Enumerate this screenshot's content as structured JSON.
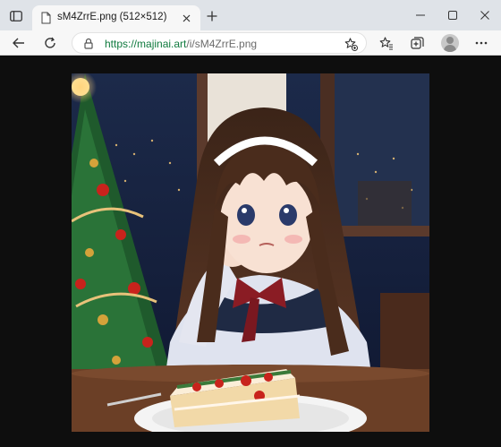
{
  "tab": {
    "title": "sM4ZrrE.png (512×512)"
  },
  "address": {
    "scheme": "https://",
    "host": "majinai.art",
    "path": "/i/sM4ZrrE.png"
  },
  "image": {
    "alt": "Anime girl in school uniform resting her cheek on her hand beside a Christmas tree and a slice of cake, night city window behind"
  },
  "icons": {
    "tab_actions": "tab-actions-icon",
    "page": "page-icon",
    "close": "close-icon",
    "new_tab": "plus-icon",
    "minimize": "minimize-icon",
    "maximize": "maximize-icon",
    "window_close": "close-icon",
    "back": "back-arrow-icon",
    "refresh": "refresh-icon",
    "lock": "lock-icon",
    "favorite": "star-add-icon",
    "favorites": "favorites-icon",
    "collections": "collections-icon",
    "profile": "profile-icon",
    "menu": "ellipsis-icon"
  }
}
